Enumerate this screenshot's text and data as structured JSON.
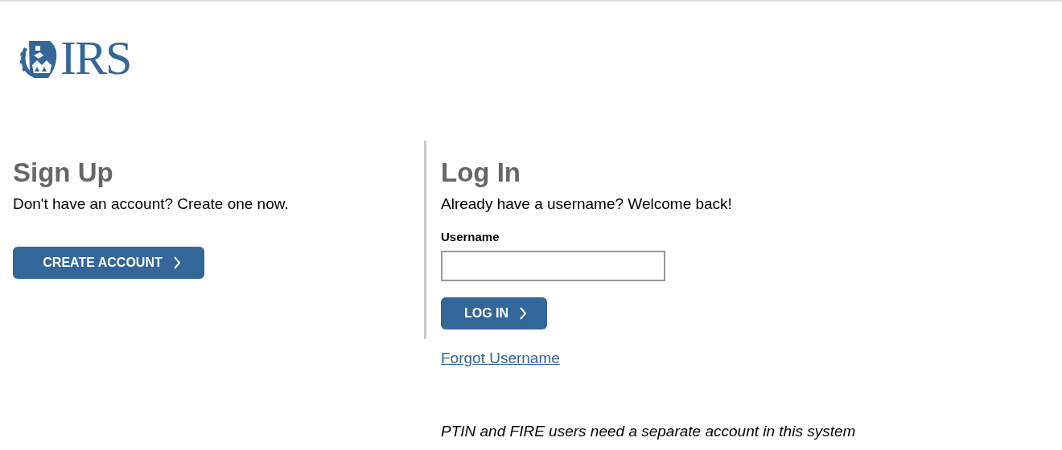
{
  "logo": {
    "text": "IRS"
  },
  "sign_up": {
    "heading": "Sign Up",
    "text": "Don't have an account? Create one now.",
    "button": "CREATE ACCOUNT"
  },
  "log_in": {
    "heading": "Log In",
    "text": "Already have a username? Welcome back!",
    "username_label": "Username",
    "button": "LOG IN",
    "link": "Forgot Username",
    "note": "PTIN and FIRE users need a separate account in this system"
  }
}
